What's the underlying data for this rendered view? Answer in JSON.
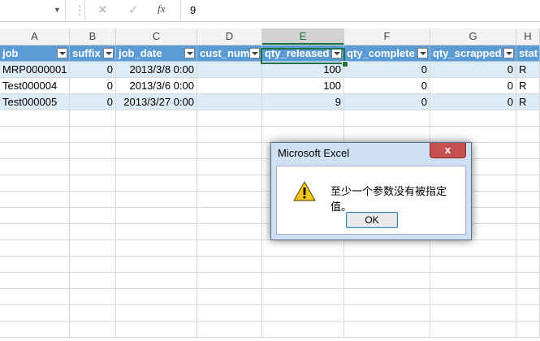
{
  "formula_bar": {
    "name_box": "",
    "cancel_icon": "✕",
    "enter_icon": "✓",
    "fx_label": "fx",
    "value": "9"
  },
  "columns": [
    "A",
    "B",
    "C",
    "D",
    "E",
    "F",
    "G",
    "H"
  ],
  "active_column": "E",
  "table": {
    "headers": [
      "job",
      "suffix",
      "job_date",
      "cust_num",
      "qty_released",
      "qty_complete",
      "qty_scrapped",
      "stat"
    ],
    "rows": [
      [
        "MRP0000001",
        "0",
        "2013/3/8 0:00",
        "",
        "100",
        "0",
        "0",
        "R"
      ],
      [
        "Test000004",
        "0",
        "2013/3/6 0:00",
        "",
        "100",
        "0",
        "0",
        "R"
      ],
      [
        "Test000005",
        "0",
        "2013/3/27 0:00",
        "",
        "9",
        "0",
        "0",
        "R"
      ]
    ]
  },
  "colors": {
    "header_fill": "#5b9bd5",
    "band_fill": "#ddebf7",
    "selection": "#217346",
    "close_button": "#c75050"
  },
  "dialog": {
    "title": "Microsoft Excel",
    "close_label": "x",
    "icon": "warning-icon",
    "message": "至少一个参数没有被指定值。",
    "ok_label": "OK"
  }
}
